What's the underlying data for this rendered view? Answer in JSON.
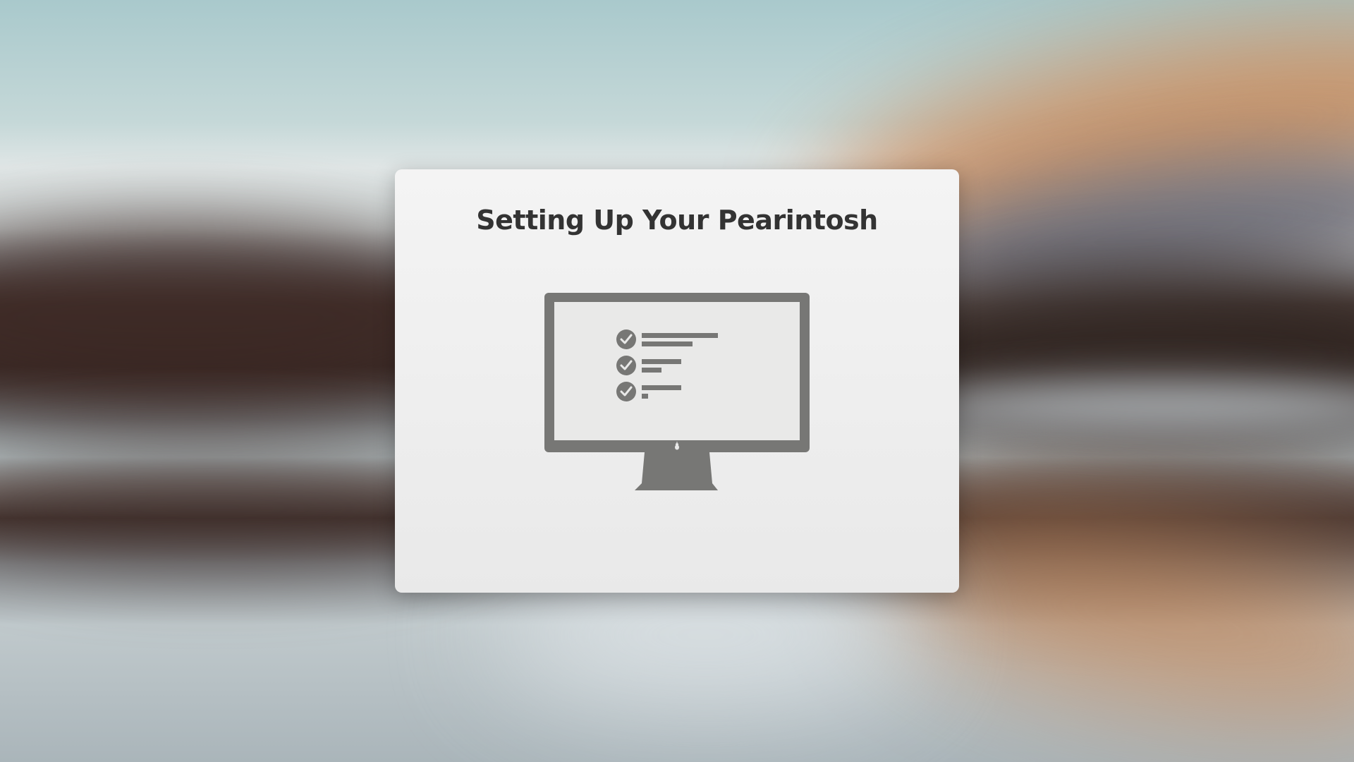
{
  "setup": {
    "title": "Setting Up Your Pearintosh"
  },
  "icons": {
    "illustration": "monitor-with-checklist-icon",
    "check": "checkmark-circle-icon",
    "logo": "pear-logo-icon"
  },
  "colors": {
    "dialog_background": "#f0f0f0",
    "title_text": "#333333",
    "illustration": "#777775"
  }
}
